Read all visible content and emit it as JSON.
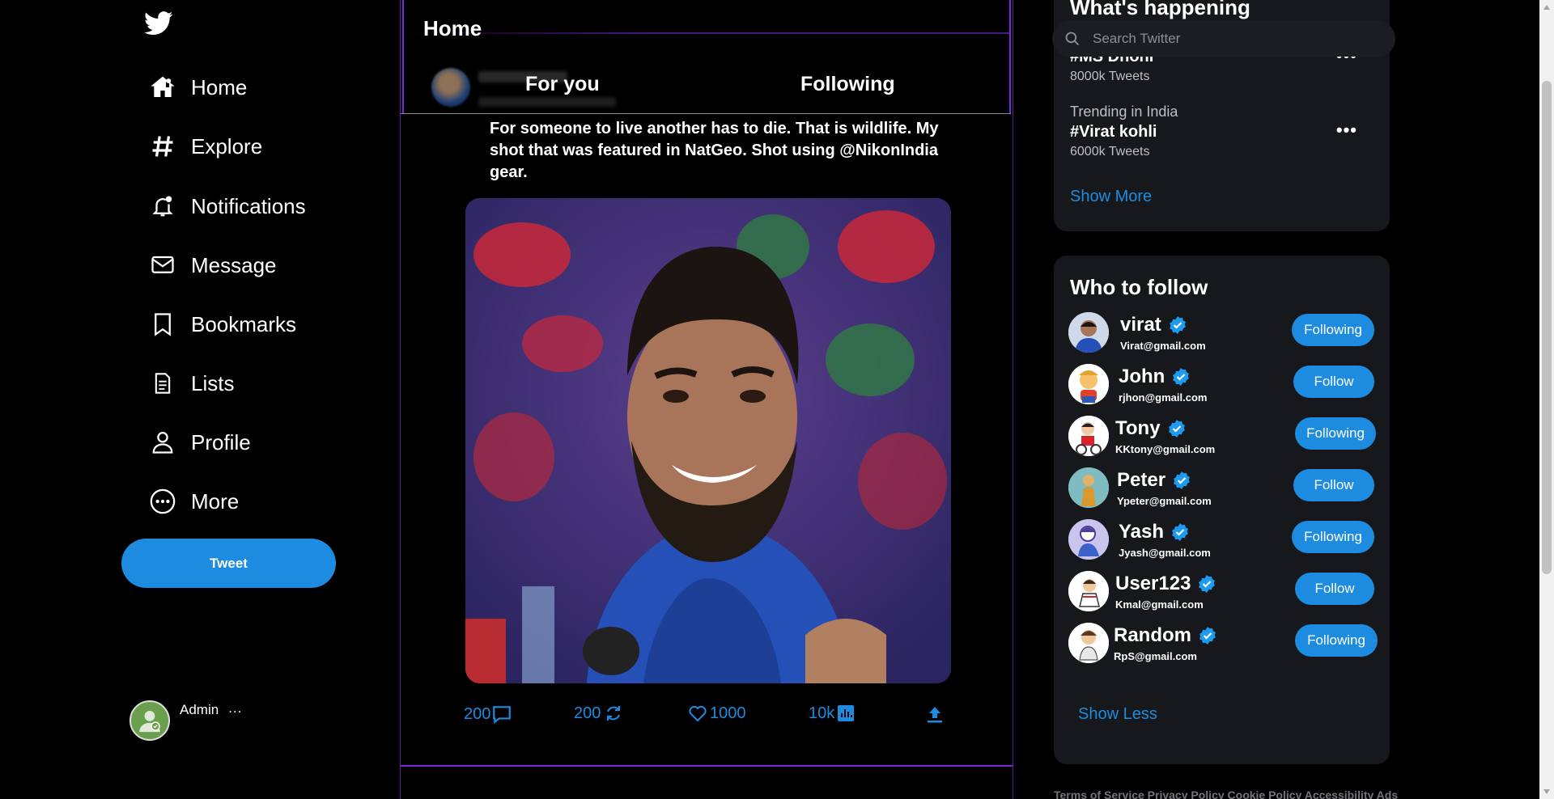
{
  "sidebar": {
    "logo_icon": "twitter-bird-icon",
    "nav": [
      {
        "label": "Home",
        "icon": "home-icon"
      },
      {
        "label": "Explore",
        "icon": "hashtag-icon"
      },
      {
        "label": "Notifications",
        "icon": "bell-icon"
      },
      {
        "label": "Message",
        "icon": "mail-icon"
      },
      {
        "label": "Bookmarks",
        "icon": "bookmark-icon"
      },
      {
        "label": "Lists",
        "icon": "list-icon"
      },
      {
        "label": "Profile",
        "icon": "user-icon"
      },
      {
        "label": "More",
        "icon": "more-circle-icon"
      }
    ],
    "tweet_button": "Tweet",
    "account": {
      "name": "Admin",
      "menu": "..."
    }
  },
  "main": {
    "title": "Home",
    "tabs": [
      {
        "label": "For you"
      },
      {
        "label": "Following"
      }
    ],
    "post": {
      "text": "For someone to live another has to die. That is wildlife. My shot that was featured in NatGeo. Shot using @NikonIndia gear.",
      "actions": {
        "replies": "200",
        "retweets": "200",
        "likes": "1000",
        "views": "10k"
      }
    }
  },
  "right": {
    "search": {
      "placeholder": "Search Twitter"
    },
    "trends": {
      "header": "What's happening",
      "items": [
        {
          "category": "",
          "tag": "#MS Dhoni",
          "count": "8000k Tweets"
        },
        {
          "category": "Trending in India",
          "tag": "#Virat kohli",
          "count": "6000k Tweets"
        }
      ],
      "show_more": "Show More"
    },
    "who_to_follow": {
      "header": "Who to follow",
      "users": [
        {
          "name": "virat",
          "email": "Virat@gmail.com",
          "button": "Following"
        },
        {
          "name": "John",
          "email": "rjhon@gmail.com",
          "button": "Follow"
        },
        {
          "name": "Tony",
          "email": "KKtony@gmail.com",
          "button": "Following"
        },
        {
          "name": "Peter",
          "email": "Ypeter@gmail.com",
          "button": "Follow"
        },
        {
          "name": "Yash",
          "email": "Jyash@gmail.com",
          "button": "Following"
        },
        {
          "name": "User123",
          "email": "Kmal@gmail.com",
          "button": "Follow"
        },
        {
          "name": "Random",
          "email": "RpS@gmail.com",
          "button": "Following"
        }
      ],
      "show_less": "Show Less"
    },
    "footer": "Terms of Service Privacy Policy Cookie Policy Accessibility Ads"
  },
  "colors": {
    "accent": "#1d8ce0",
    "background": "#000000",
    "card": "#16181c",
    "border_purple": "#7b2bd6"
  }
}
